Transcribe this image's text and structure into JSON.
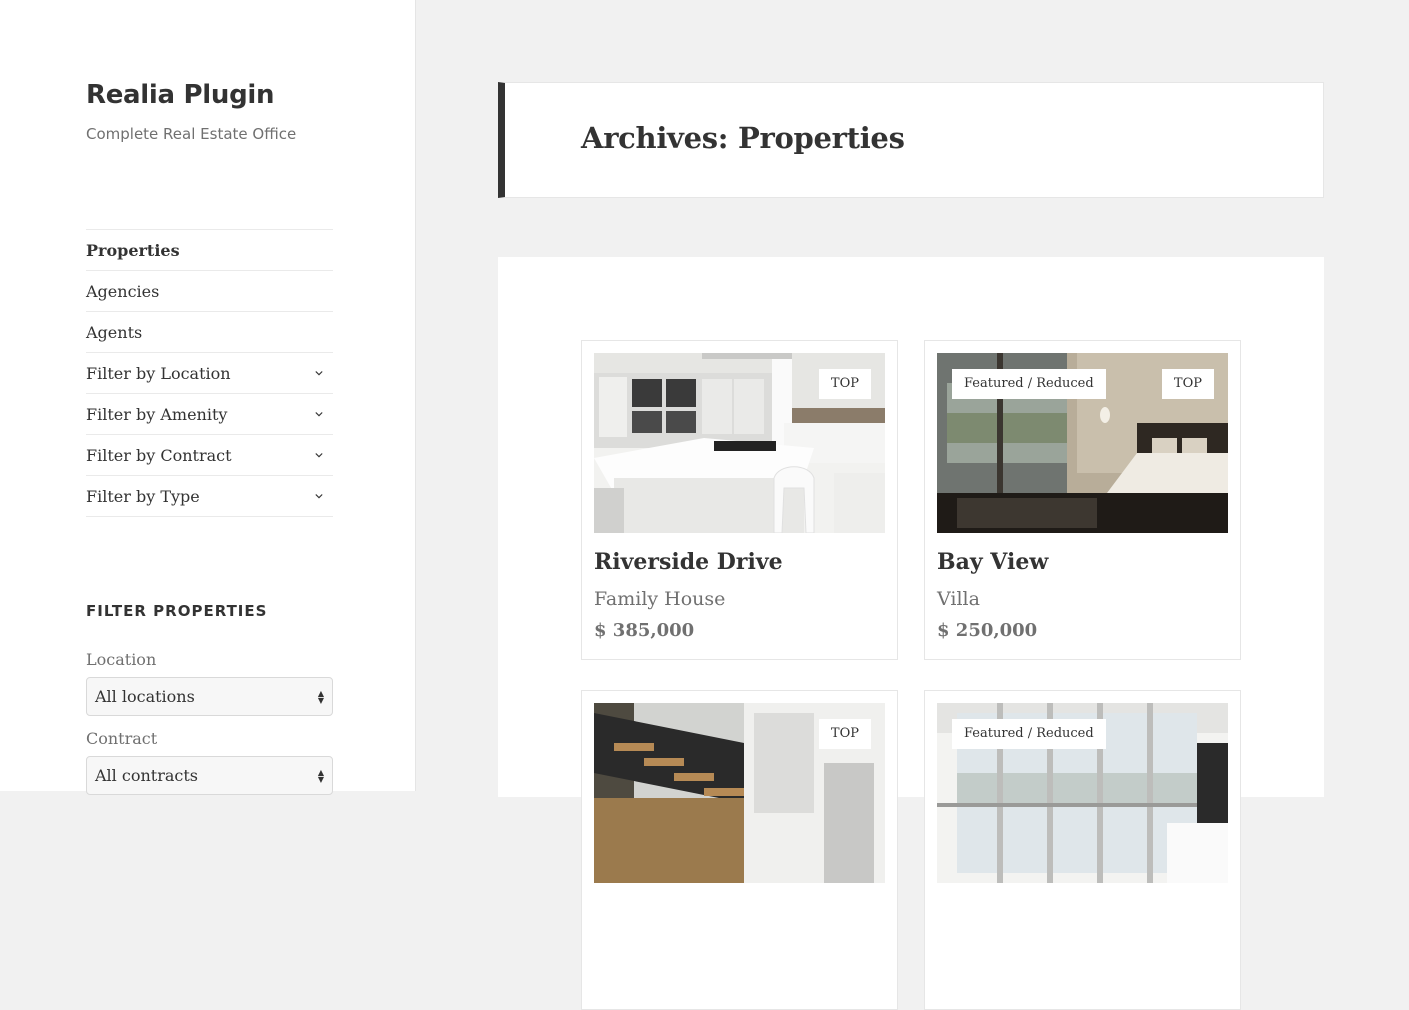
{
  "site": {
    "title": "Realia Plugin",
    "description": "Complete Real Estate Office"
  },
  "nav": [
    {
      "label": "Properties",
      "active": true,
      "has_submenu": false
    },
    {
      "label": "Agencies",
      "active": false,
      "has_submenu": false
    },
    {
      "label": "Agents",
      "active": false,
      "has_submenu": false
    },
    {
      "label": "Filter by Location",
      "active": false,
      "has_submenu": true,
      "icon": "chevron-down-icon"
    },
    {
      "label": "Filter by Amenity",
      "active": false,
      "has_submenu": true,
      "icon": "chevron-down-icon"
    },
    {
      "label": "Filter by Contract",
      "active": false,
      "has_submenu": true,
      "icon": "chevron-down-icon"
    },
    {
      "label": "Filter by Type",
      "active": false,
      "has_submenu": true,
      "icon": "chevron-down-icon"
    }
  ],
  "filter": {
    "title": "FILTER PROPERTIES",
    "location_label": "Location",
    "location_value": "All locations",
    "contract_label": "Contract",
    "contract_value": "All contracts"
  },
  "archive": {
    "title": "Archives: Properties"
  },
  "properties": [
    {
      "title": "Riverside Drive",
      "type": "Family House",
      "price": "$ 385,000",
      "badge_left": "",
      "badge_right": "TOP",
      "image": "kitchen-photo"
    },
    {
      "title": "Bay View",
      "type": "Villa",
      "price": "$ 250,000",
      "badge_left": "Featured / Reduced",
      "badge_right": "TOP",
      "image": "bedroom-photo"
    },
    {
      "title": "",
      "type": "",
      "price": "",
      "badge_left": "",
      "badge_right": "TOP",
      "image": "staircase-photo"
    },
    {
      "title": "",
      "type": "",
      "price": "",
      "badge_left": "Featured / Reduced",
      "badge_right": "",
      "image": "living-room-photo"
    }
  ],
  "colors": {
    "sidebar_bg": "#ffffff",
    "page_bg": "#f1f1f1",
    "accent_border": "#333333",
    "muted_text": "#707070"
  }
}
